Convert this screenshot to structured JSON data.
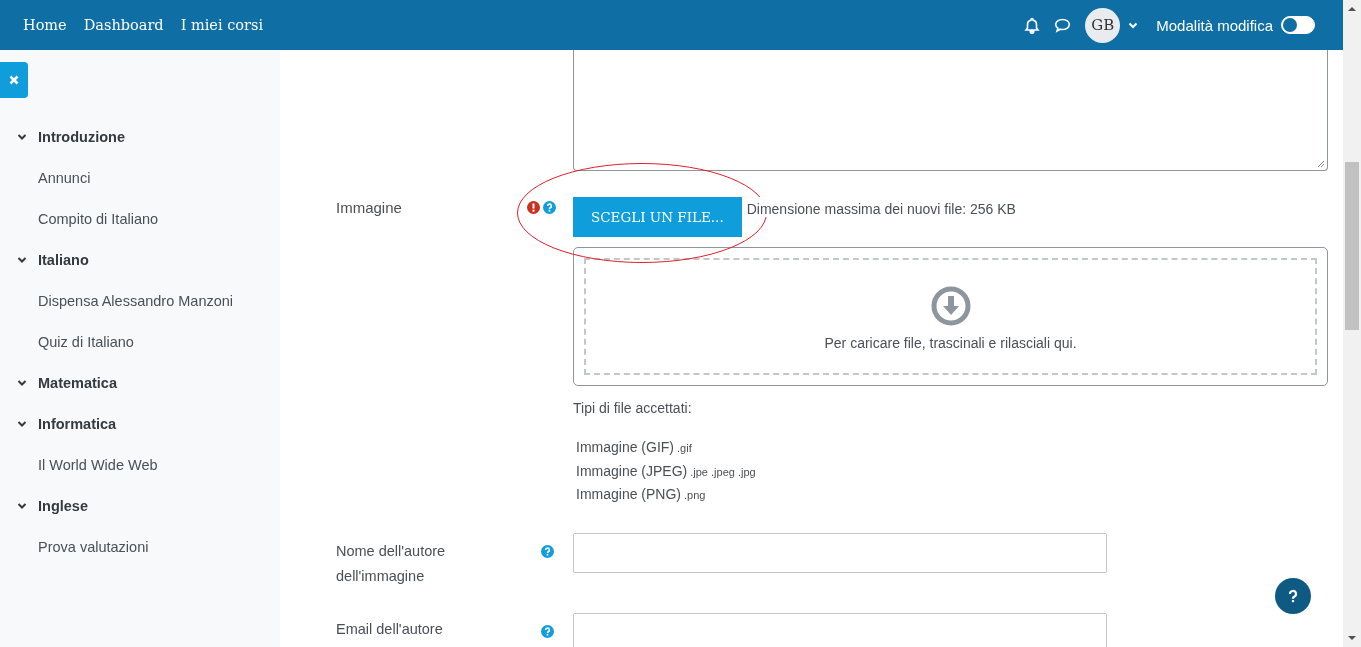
{
  "navbar": {
    "links": [
      "Home",
      "Dashboard",
      "I miei corsi"
    ],
    "avatar": "GB",
    "edit_mode": {
      "label": "Modalità modifica",
      "on": false
    }
  },
  "sidebar": {
    "sections": [
      {
        "title": "Introduzione",
        "expanded": true,
        "children": [
          {
            "title": "Annunci"
          },
          {
            "title": "Compito di Italiano"
          }
        ]
      },
      {
        "title": "Italiano",
        "expanded": true,
        "children": [
          {
            "title": "Dispensa Alessandro Manzoni"
          },
          {
            "title": "Quiz di Italiano"
          }
        ]
      },
      {
        "title": "Matematica",
        "expanded": true
      },
      {
        "title": "Informatica",
        "expanded": true,
        "children": [
          {
            "title": "Il World Wide Web"
          }
        ]
      },
      {
        "title": "Inglese",
        "expanded": true,
        "children": [
          {
            "title": "Prova valutazioni"
          }
        ]
      }
    ]
  },
  "image_field": {
    "label": "Immagine",
    "required": true,
    "button": "SCEGLI UN FILE...",
    "max_size": "Dimensione massima dei nuovi file: 256 KB",
    "dropzone": "Per caricare file, trascinali e rilasciali qui.",
    "accepted_heading": "Tipi di file accettati:",
    "accepted_types": [
      {
        "name": "Immagine (GIF)",
        "extensions": ".gif"
      },
      {
        "name": "Immagine (JPEG)",
        "extensions": ".jpe .jpeg .jpg"
      },
      {
        "name": "Immagine (PNG)",
        "extensions": ".png"
      }
    ]
  },
  "fields": [
    {
      "label": "Nome dell'autore dell'immagine"
    },
    {
      "label": "Email dell'autore"
    }
  ]
}
